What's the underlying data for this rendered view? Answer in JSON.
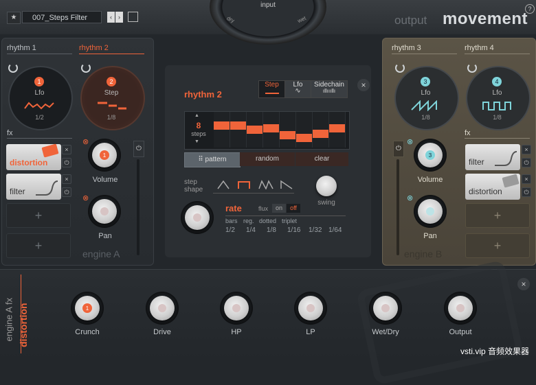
{
  "header": {
    "preset_name": "007_Steps Filter",
    "output_label": "output",
    "logo_text": "movement",
    "help_label": "?",
    "input_label": "input",
    "dry_label": "dry",
    "wet_label": "wet"
  },
  "engineA": {
    "rhythm1_tab": "rhythm 1",
    "rhythm2_tab": "rhythm 2",
    "rhythm1": {
      "number": "1",
      "type": "Lfo",
      "rate": "1/2"
    },
    "rhythm2": {
      "number": "2",
      "type": "Step",
      "rate": "1/8"
    },
    "fx_label": "fx",
    "fx_slots": [
      "distortion",
      "filter"
    ],
    "add_label": "+",
    "volume_label": "Volume",
    "volume_badge": "1",
    "pan_label": "Pan",
    "engine_label": "engine A"
  },
  "engineB": {
    "rhythm3_tab": "rhythm 3",
    "rhythm4_tab": "rhythm 4",
    "rhythm3": {
      "number": "3",
      "type": "Lfo",
      "rate": "1/8"
    },
    "rhythm4": {
      "number": "4",
      "type": "Lfo",
      "rate": "1/8"
    },
    "fx_label": "fx",
    "fx_slots": [
      "filter",
      "distortion"
    ],
    "add_label": "+",
    "volume_label": "Volume",
    "volume_badge": "3",
    "pan_label": "Pan",
    "engine_label": "engine B"
  },
  "center": {
    "title": "rhythm 2",
    "modes": [
      "Step",
      "Lfo",
      "Sidechain"
    ],
    "close_label": "×",
    "steps_count": "8",
    "steps_label": "steps",
    "step_values": [
      0.65,
      0.65,
      0.5,
      0.55,
      0.3,
      0.2,
      0.35,
      0.55
    ],
    "pattern_btn": "pattern",
    "random_btn": "random",
    "clear_btn": "clear",
    "step_shape_label": "step\nshape",
    "swing_label": "swing",
    "rate_label": "rate",
    "flux_label": "flux",
    "flux_on": "on",
    "flux_off": "off",
    "rate_modes": [
      "bars",
      "reg.",
      "dotted",
      "triplet"
    ],
    "rate_values": [
      "1/2",
      "1/4",
      "1/8",
      "1/16",
      "1/32",
      "1/64"
    ]
  },
  "fx_panel": {
    "engine_label": "engine A fx",
    "fx_name": "distortion",
    "close_label": "×",
    "knobs": [
      "Crunch",
      "Drive",
      "HP",
      "LP",
      "Wet/Dry",
      "Output"
    ],
    "crunch_badge": "1"
  },
  "watermark": "vsti.vip 音频效果器",
  "colors": {
    "accent": "#f0643a",
    "cyan": "#7fd4da",
    "panel": "#2f3337",
    "tan": "#5b5446"
  }
}
